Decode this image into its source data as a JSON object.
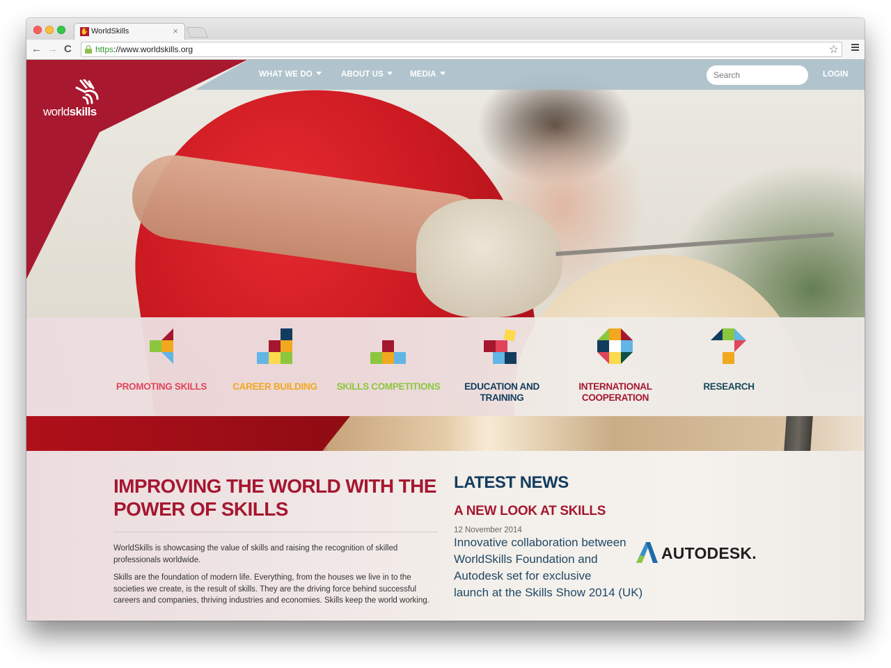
{
  "browser": {
    "tab_title": "WorldSkills",
    "tab_close": "×",
    "url_scheme": "https",
    "url_rest": "://www.worldskills.org",
    "nav": {
      "back": "←",
      "forward": "→",
      "reload": "C"
    },
    "bookmark_icon": "☆"
  },
  "site": {
    "brand_color": "#a5172f",
    "logo": {
      "light": "world",
      "bold": "skills"
    },
    "nav": [
      {
        "label": "WHAT WE DO",
        "has_dropdown": true
      },
      {
        "label": "ABOUT US",
        "has_dropdown": true
      },
      {
        "label": "MEDIA",
        "has_dropdown": true
      }
    ],
    "search": {
      "placeholder": "Search",
      "value": ""
    },
    "login": "LOGIN"
  },
  "pillars": [
    {
      "label": "PROMOTING SKILLS",
      "color": "#e0455b",
      "icon": "promoting-skills-icon"
    },
    {
      "label": "CAREER BUILDING",
      "color": "#f1a81e",
      "icon": "career-building-icon"
    },
    {
      "label": "SKILLS COMPETITIONS",
      "color": "#8cc63f",
      "icon": "skills-competitions-icon"
    },
    {
      "label": "EDUCATION AND TRAINING",
      "color": "#123c5e",
      "icon": "education-training-icon"
    },
    {
      "label": "INTERNATIONAL COOPERATION",
      "color": "#a5172f",
      "icon": "international-cooperation-icon"
    },
    {
      "label": "RESEARCH",
      "color": "#17485a",
      "icon": "research-icon"
    }
  ],
  "mission": {
    "title": "IMPROVING THE WORLD WITH THE POWER OF SKILLS",
    "paragraphs": [
      "WorldSkills is showcasing the value of skills and raising the recognition of skilled professionals worldwide.",
      "Skills are the foundation of modern life. Everything, from the houses we live in to the societies we create, is the result of skills. They are the driving force behind successful careers and companies, thriving industries and economies. Skills keep the world working."
    ]
  },
  "news": {
    "heading": "LATEST NEWS",
    "items": [
      {
        "title": "A NEW LOOK AT SKILLS",
        "date": "12 November 2014",
        "summary": "Innovative collaboration between WorldSkills Foundation and Autodesk set for exclusive launch at the Skills Show 2014 (UK)",
        "partner_logo": "AUTODESK."
      }
    ]
  }
}
